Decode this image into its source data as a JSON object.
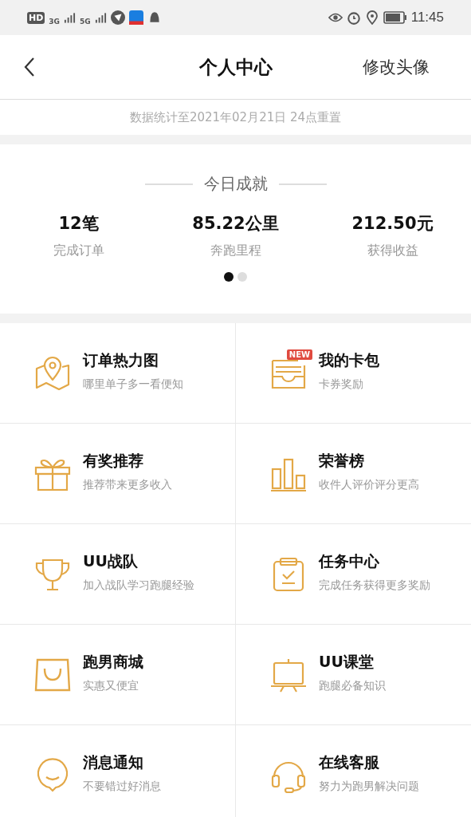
{
  "status_bar": {
    "network": [
      "HD",
      "3G",
      "5G"
    ],
    "time": "11:45"
  },
  "header": {
    "title": "个人中心",
    "action": "修改头像"
  },
  "notice": "数据统计至2021年02月21日 24点重置",
  "achievements": {
    "title": "今日成就",
    "stats": [
      {
        "value": "12笔",
        "label": "完成订单"
      },
      {
        "value": "85.22公里",
        "label": "奔跑里程"
      },
      {
        "value": "212.50元",
        "label": "获得收益"
      }
    ],
    "pages": [
      {
        "selected": true
      },
      {
        "selected": false
      }
    ]
  },
  "menu": [
    {
      "title": "订单热力图",
      "subtitle": "哪里单子多一看便知"
    },
    {
      "title": "我的卡包",
      "subtitle": "卡券奖励",
      "badge": "NEW"
    },
    {
      "title": "有奖推荐",
      "subtitle": "推荐带来更多收入"
    },
    {
      "title": "荣誉榜",
      "subtitle": "收件人评价评分更高"
    },
    {
      "title": "UU战队",
      "subtitle": "加入战队学习跑腿经验"
    },
    {
      "title": "任务中心",
      "subtitle": "完成任务获得更多奖励"
    },
    {
      "title": "跑男商城",
      "subtitle": "实惠又便宜"
    },
    {
      "title": "UU课堂",
      "subtitle": "跑腿必备知识"
    },
    {
      "title": "消息通知",
      "subtitle": "不要错过好消息"
    },
    {
      "title": "在线客服",
      "subtitle": "努力为跑男解决问题"
    }
  ]
}
